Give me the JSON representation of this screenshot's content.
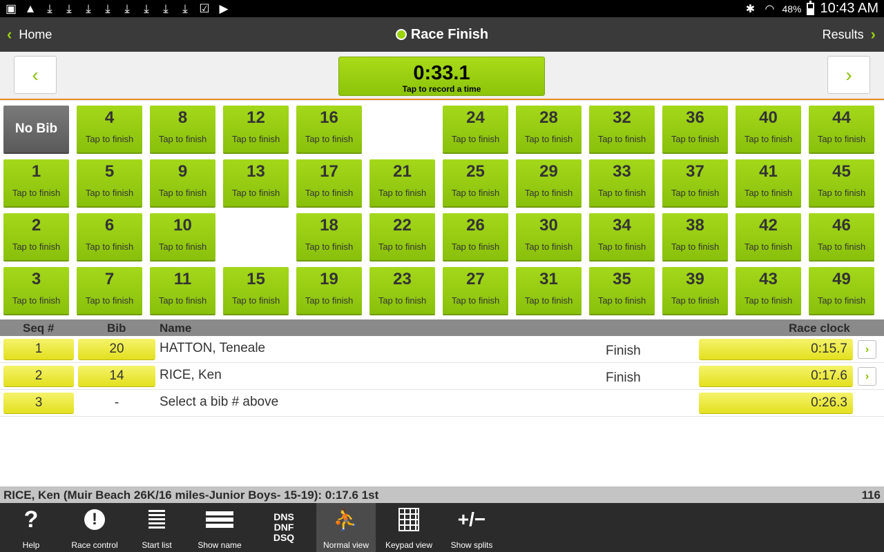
{
  "status_bar": {
    "left_icons": [
      "image-icon",
      "warning-icon",
      "download-icon",
      "download-icon",
      "download-icon",
      "download-icon",
      "download-icon",
      "download-icon",
      "download-icon",
      "download-icon",
      "clipboard-check-icon",
      "play-store-icon"
    ],
    "battery": "48%",
    "time": "10:43 AM"
  },
  "action_bar": {
    "back_label": "Home",
    "title": "Race Finish",
    "forward_label": "Results"
  },
  "timer": {
    "time": "0:33.1",
    "hint": "Tap to record a time",
    "prev_glyph": "‹",
    "next_glyph": "›"
  },
  "bib_grid": {
    "no_bib_label": "No Bib",
    "finish_label": "Tap to finish",
    "columns": [
      [
        null,
        1,
        2,
        3
      ],
      [
        4,
        5,
        6,
        7
      ],
      [
        8,
        9,
        10,
        11
      ],
      [
        12,
        13,
        null,
        15
      ],
      [
        16,
        17,
        18,
        19
      ],
      [
        null,
        21,
        22,
        23
      ],
      [
        24,
        25,
        26,
        27
      ],
      [
        28,
        29,
        30,
        31
      ],
      [
        32,
        33,
        34,
        35
      ],
      [
        36,
        37,
        38,
        39
      ],
      [
        40,
        41,
        42,
        43
      ],
      [
        44,
        45,
        46,
        49
      ]
    ]
  },
  "results": {
    "headers": {
      "seq": "Seq #",
      "bib": "Bib",
      "name": "Name",
      "clock": "Race clock"
    },
    "rows": [
      {
        "seq": "1",
        "bib": "20",
        "name": "HATTON, Teneale",
        "status": "Finish",
        "clock": "0:15.7"
      },
      {
        "seq": "2",
        "bib": "14",
        "name": "RICE, Ken",
        "status": "Finish",
        "clock": "0:17.6"
      },
      {
        "seq": "3",
        "bib": "-",
        "name": "Select a bib # above",
        "status": "",
        "clock": "0:26.3"
      }
    ]
  },
  "info_bar": {
    "text": "RICE, Ken (Muir Beach 26K/16 miles-Junior Boys- 15-19): 0:17.6 1st",
    "count": "116"
  },
  "toolbar": {
    "help": "Help",
    "race_control": "Race control",
    "start_list": "Start list",
    "show_name": "Show name",
    "dns_lines": [
      "DNS",
      "DNF",
      "DSQ"
    ],
    "normal_view": "Normal view",
    "keypad_view": "Keypad view",
    "show_splits": "Show splits"
  }
}
